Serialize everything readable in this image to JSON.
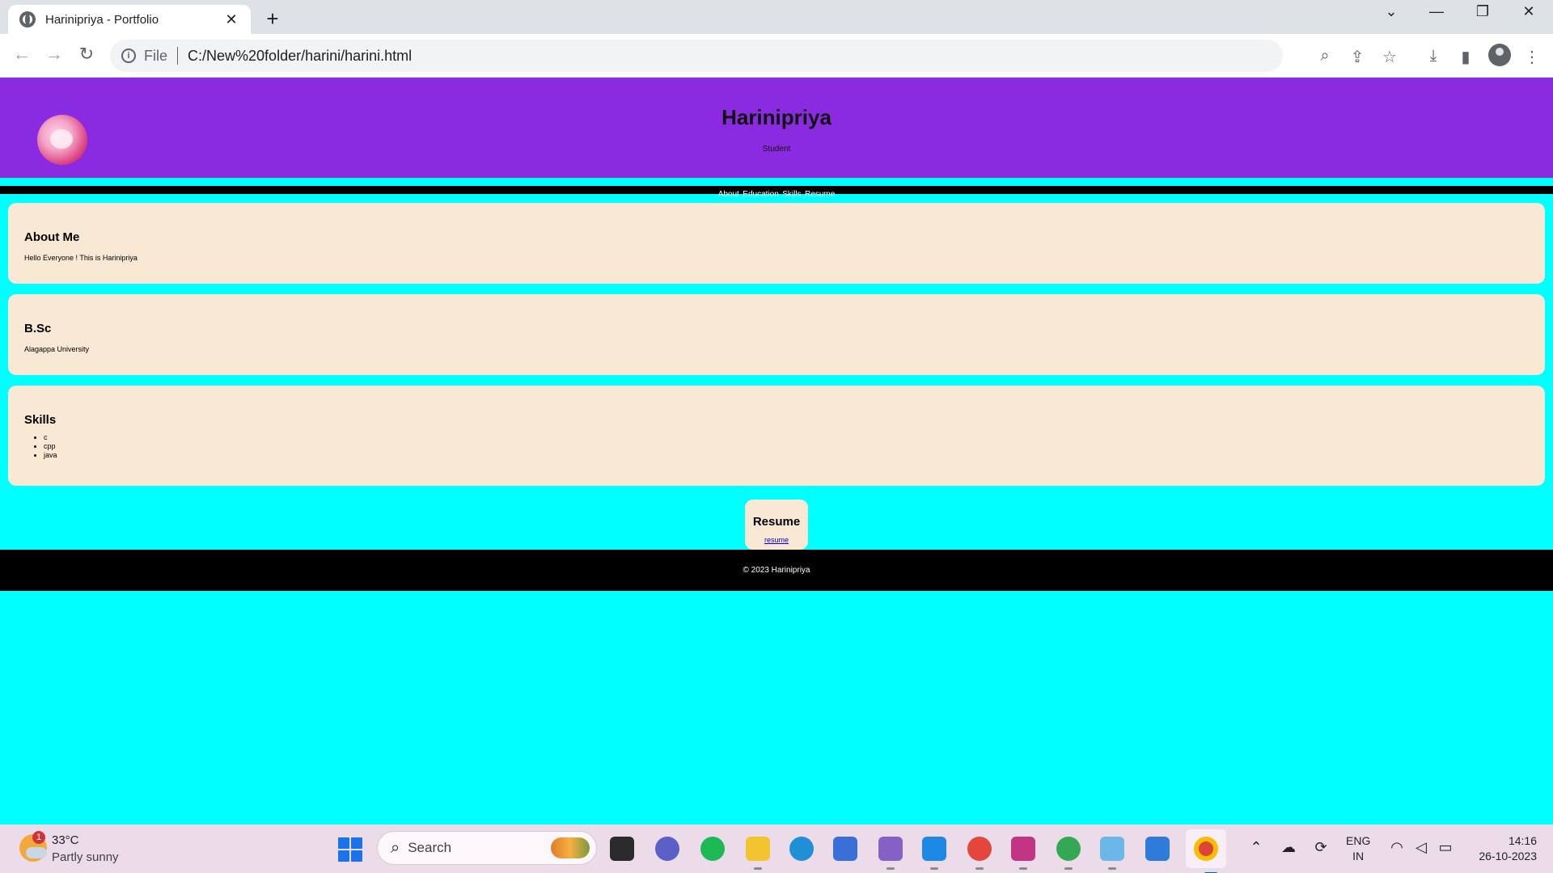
{
  "browser": {
    "tab_title": "Harinipriya - Portfolio",
    "new_tab": "+",
    "address_scheme": "File",
    "address_url": "C:/New%20folder/harini/harini.html",
    "window_controls": [
      "⌄",
      "—",
      "❐",
      "✕"
    ]
  },
  "site": {
    "name": "Harinipriya",
    "subtitle": "Student",
    "nav": [
      "About",
      "Education",
      "Skills",
      "Resume"
    ],
    "about": {
      "heading": "About Me",
      "text": "Hello Everyone ! This is Harinipriya"
    },
    "education": {
      "heading": "B.Sc",
      "text": "Alagappa University"
    },
    "skills": {
      "heading": "Skills",
      "items": [
        "c",
        "cpp",
        "java"
      ]
    },
    "resume": {
      "heading": "Resume",
      "link_text": "resume"
    },
    "footer": "© 2023 Harinipriya"
  },
  "taskbar": {
    "weather_badge": "1",
    "weather_temp": "33°C",
    "weather_desc": "Partly sunny",
    "search_placeholder": "Search",
    "apps": [
      "task-view",
      "teams-chat",
      "spotify",
      "file-explorer",
      "edge",
      "microsoft-store",
      "visual-studio",
      "vscode",
      "chrome-profile-a",
      "canva",
      "chrome-profile-h",
      "paint",
      "photos",
      "chrome"
    ],
    "lang_top": "ENG",
    "lang_bottom": "IN",
    "time": "14:16",
    "date": "26-10-2023"
  },
  "colors": {
    "header_purple": "#8a2be2",
    "page_cyan": "#00ffff",
    "card_bg": "#f8e8d4",
    "nav_footer_black": "#000000"
  }
}
